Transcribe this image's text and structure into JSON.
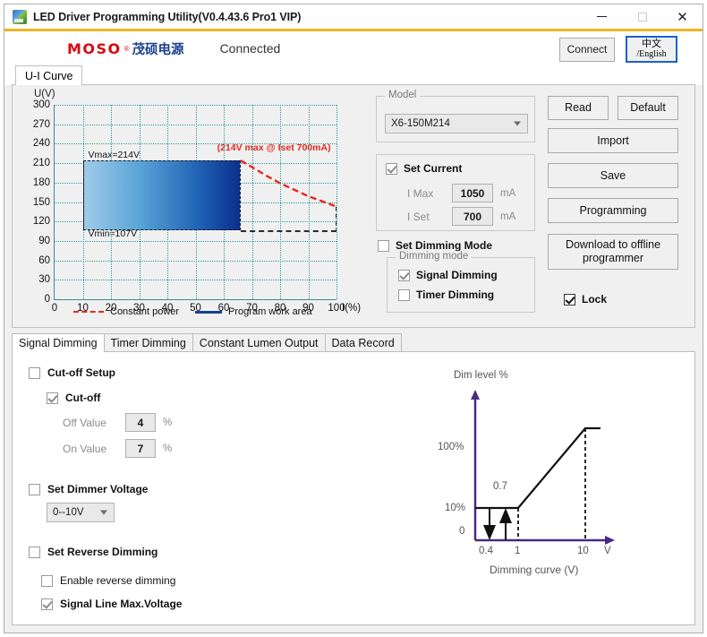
{
  "window": {
    "title": "LED Driver Programming Utility(V0.4.43.6 Pro1 VIP)",
    "icon": "app-icon",
    "minimize": "–",
    "maximize": "□",
    "close": "✕",
    "accent_color": "#f0b323"
  },
  "header": {
    "logo_primary": "MOSO",
    "logo_reg": "®",
    "logo_secondary": "茂硕电源",
    "logo_color_primary": "#d60a14",
    "logo_color_secondary": "#1b3f8f",
    "status": "Connected",
    "connect_button": "Connect",
    "lang_cn": "中文",
    "lang_en": "/English"
  },
  "top_tabs": [
    {
      "label": "U-I Curve",
      "active": true
    }
  ],
  "chart_data": {
    "type": "line",
    "title": "",
    "xlabel": "I(%)",
    "ylabel": "U(V)",
    "xlim": [
      0,
      100
    ],
    "ylim": [
      0,
      300
    ],
    "xticks": [
      0,
      10,
      20,
      30,
      40,
      50,
      60,
      70,
      80,
      90,
      100
    ],
    "yticks": [
      0,
      30,
      60,
      90,
      120,
      150,
      180,
      210,
      240,
      270,
      300
    ],
    "grid": true,
    "grid_color": "#2e9e9e",
    "annotations": [
      {
        "text": "Vmax=214V",
        "x": 10,
        "y": 222
      },
      {
        "text": "Vmin=107V",
        "x": 10,
        "y": 100
      },
      {
        "text": "(214V max @ Iset 700mA)",
        "x": 64,
        "y": 232,
        "color": "#e8271f"
      }
    ],
    "series": [
      {
        "name": "Constant power",
        "style": "dashed",
        "color": "#e8271f",
        "x": [
          66,
          70,
          75,
          80,
          85,
          90,
          95,
          100
        ],
        "y": [
          214,
          204,
          191,
          179,
          169,
          159,
          151,
          143
        ]
      },
      {
        "name": "Program work area",
        "style": "filled-region",
        "color": "#1b3f8f",
        "x_range": [
          10,
          66
        ],
        "y_range": [
          107,
          214
        ]
      }
    ],
    "legend": [
      {
        "label": "Constant power",
        "style": "dashed",
        "color": "#e8271f"
      },
      {
        "label": "Program work area",
        "style": "solid",
        "color": "#1b3f8f"
      }
    ],
    "legend_position": "bottom"
  },
  "model_group": {
    "title": "Model",
    "selected": "X6-150M214"
  },
  "set_current_group": {
    "checkbox_label": "Set Current",
    "checked": true,
    "disabled": true,
    "imax_label": "I Max",
    "imax_value": "1050",
    "imax_unit": "mA",
    "iset_label": "I Set",
    "iset_value": "700",
    "iset_unit": "mA"
  },
  "dimming_mode_group": {
    "checkbox_label": "Set Dimming Mode",
    "checked": false,
    "title": "Dimming mode",
    "options": [
      {
        "label": "Signal Dimming",
        "checked": true
      },
      {
        "label": "Timer Dimming",
        "checked": false
      }
    ]
  },
  "action_buttons": {
    "read": "Read",
    "default": "Default",
    "import": "Import",
    "save": "Save",
    "programming": "Programming",
    "download": "Download to offline programmer",
    "lock_label": "Lock",
    "lock_checked": true
  },
  "bottom_tabs": [
    {
      "label": "Signal Dimming",
      "active": true
    },
    {
      "label": "Timer Dimming",
      "active": false
    },
    {
      "label": "Constant Lumen Output",
      "active": false
    },
    {
      "label": "Data Record",
      "active": false
    }
  ],
  "signal_dimming": {
    "cutoff_setup_label": "Cut-off Setup",
    "cutoff_setup_checked": false,
    "cutoff_label": "Cut-off",
    "cutoff_checked": true,
    "off_value_label": "Off Value",
    "off_value": "4",
    "off_value_unit": "%",
    "on_value_label": "On Value",
    "on_value": "7",
    "on_value_unit": "%",
    "dimmer_voltage_label": "Set Dimmer Voltage",
    "dimmer_voltage_checked": false,
    "dimmer_voltage_selected": "0--10V",
    "reverse_dimming_label": "Set Reverse Dimming",
    "reverse_dimming_checked": false,
    "enable_reverse_label": "Enable reverse dimming",
    "enable_reverse_checked": false,
    "signal_line_max_label": "Signal Line Max.Voltage",
    "signal_line_max_checked": true
  },
  "dim_curve": {
    "type": "line",
    "ylabel": "Dim level %",
    "caption": "Dimming curve (V)",
    "axis_color": "#4b2a82",
    "curve_color": "#111111",
    "yticks": [
      "100%",
      "10%",
      "0"
    ],
    "xticks": [
      "0.4",
      "1",
      "10"
    ],
    "x_unit": "V",
    "marker_label": "0.7",
    "points": [
      {
        "x": 0.4,
        "y": 10
      },
      {
        "x": 1,
        "y": 10
      },
      {
        "x": 10,
        "y": 100
      },
      {
        "x": 12,
        "y": 100
      }
    ]
  }
}
